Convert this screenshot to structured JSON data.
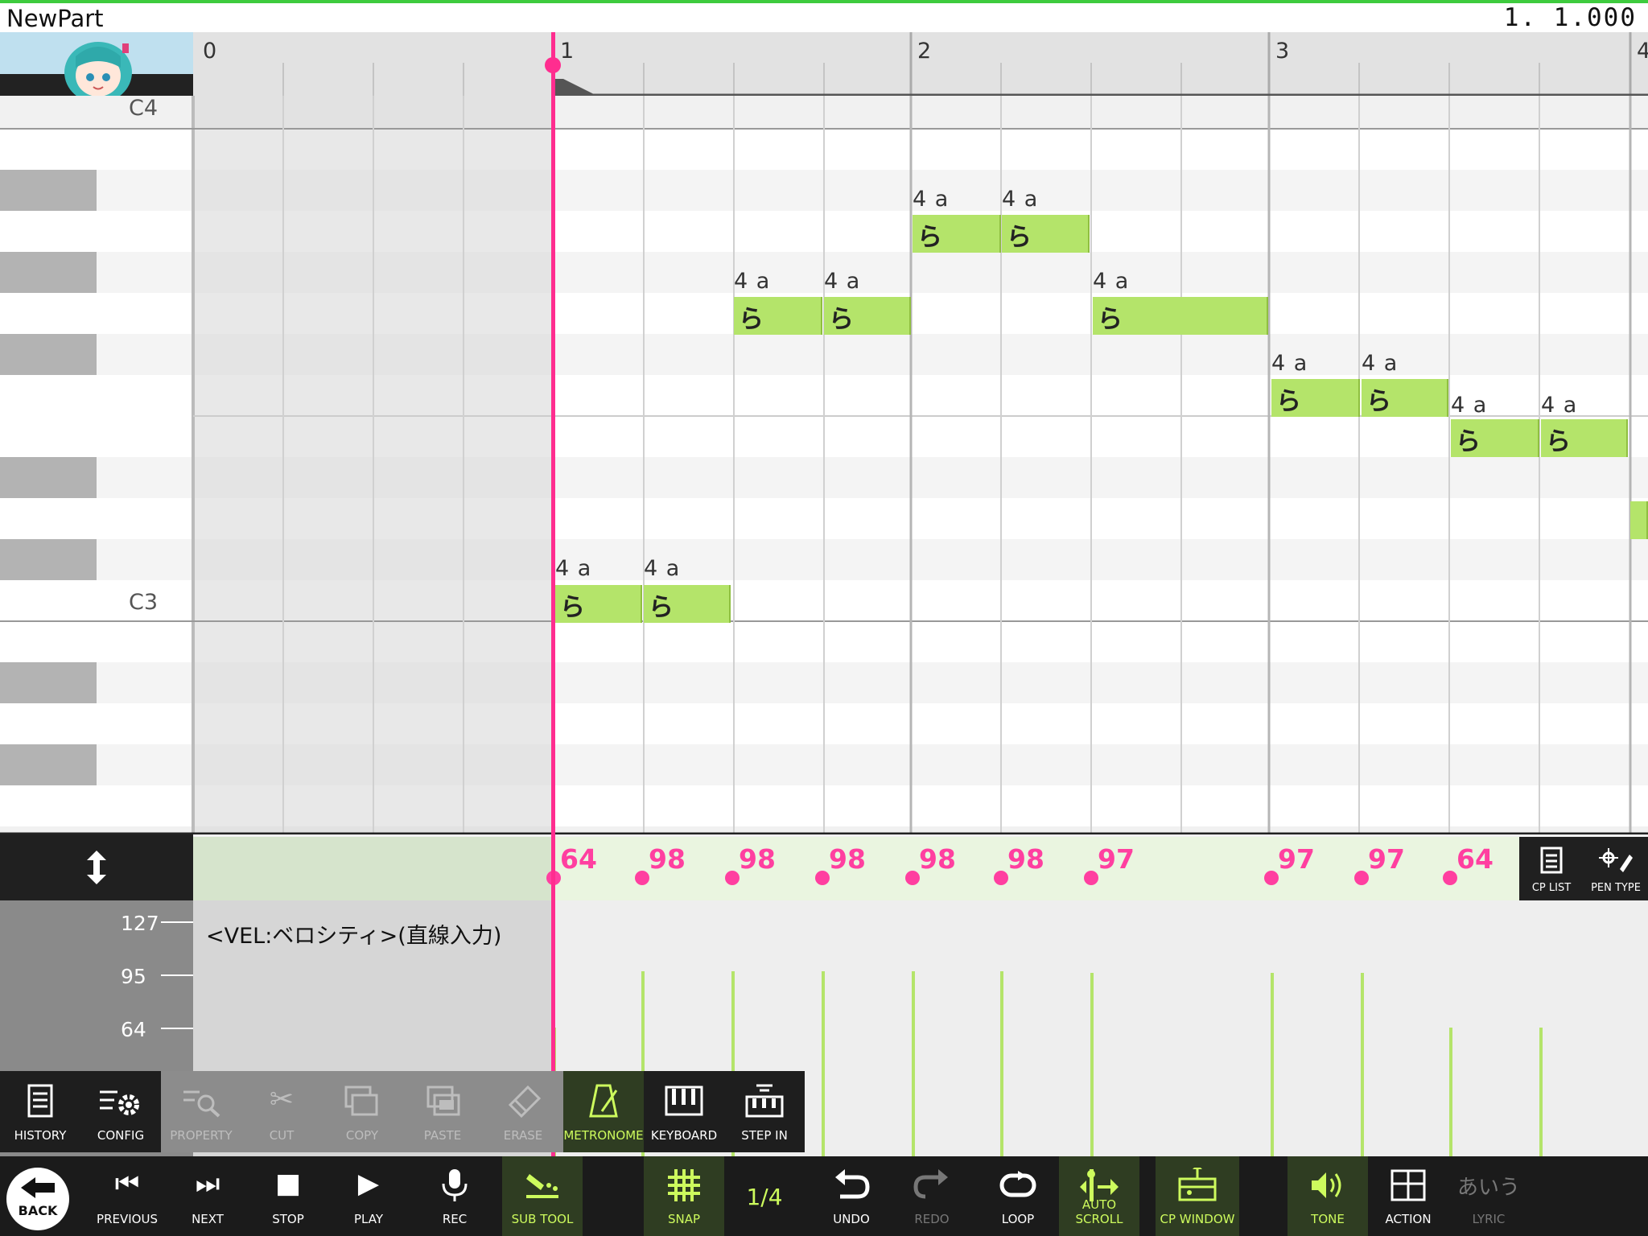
{
  "header": {
    "part_name": "NewPart",
    "position": "1. 1.000"
  },
  "timeline": {
    "bars": [
      "0",
      "1",
      "2",
      "3",
      "4"
    ]
  },
  "keys": {
    "upper": "C4",
    "lower": "C3"
  },
  "notes": [
    {
      "pitch_row": 11,
      "label": "4 a",
      "lyric": "ら"
    },
    {
      "pitch_row": 11,
      "label": "4 a",
      "lyric": "ら"
    },
    {
      "pitch_row": 6,
      "label": "4 a",
      "lyric": "ら"
    },
    {
      "pitch_row": 6,
      "label": "4 a",
      "lyric": "ら"
    },
    {
      "pitch_row": 4,
      "label": "4 a",
      "lyric": "ら"
    },
    {
      "pitch_row": 4,
      "label": "4 a",
      "lyric": "ら"
    },
    {
      "pitch_row": 6,
      "label": "4 a",
      "lyric": "ら"
    },
    {
      "pitch_row": 8,
      "label": "4 a",
      "lyric": "ら"
    },
    {
      "pitch_row": 8,
      "label": "4 a",
      "lyric": "ら"
    },
    {
      "pitch_row": 9,
      "label": "4 a",
      "lyric": "ら"
    },
    {
      "pitch_row": 9,
      "label": "4 a",
      "lyric": "ら"
    }
  ],
  "velocity": {
    "values": [
      "64",
      "98",
      "98",
      "98",
      "98",
      "98",
      "97",
      "97",
      "97",
      "64"
    ],
    "scale": [
      "127",
      "95",
      "64"
    ],
    "mode": "<VEL:ベロシティ>(直線入力)"
  },
  "cp_panel": {
    "cp_list": "CP LIST",
    "pen_type": "PEN TYPE"
  },
  "subtool": {
    "history": "HISTORY",
    "config": "CONFIG",
    "property": "PROPERTY",
    "cut": "CUT",
    "copy": "COPY",
    "paste": "PASTE",
    "erase": "ERASE",
    "metronome": "METRONOME",
    "keyboard": "KEYBOARD",
    "step_in": "STEP IN"
  },
  "transport": {
    "back": "BACK",
    "previous": "PREVIOUS",
    "next": "NEXT",
    "stop": "STOP",
    "play": "PLAY",
    "rec": "REC",
    "sub_tool": "SUB TOOL",
    "snap": "SNAP",
    "snap_value": "1/4",
    "undo": "UNDO",
    "redo": "REDO",
    "loop": "LOOP",
    "auto_scroll": "AUTO SCROLL",
    "cp_window": "CP WINDOW",
    "tone": "TONE",
    "action": "ACTION",
    "lyric_icon": "あいう",
    "lyric": "LYRIC"
  },
  "colors": {
    "accent": "#cdfb5d",
    "playhead": "#ff2d8f",
    "note": "#b4e46a"
  }
}
